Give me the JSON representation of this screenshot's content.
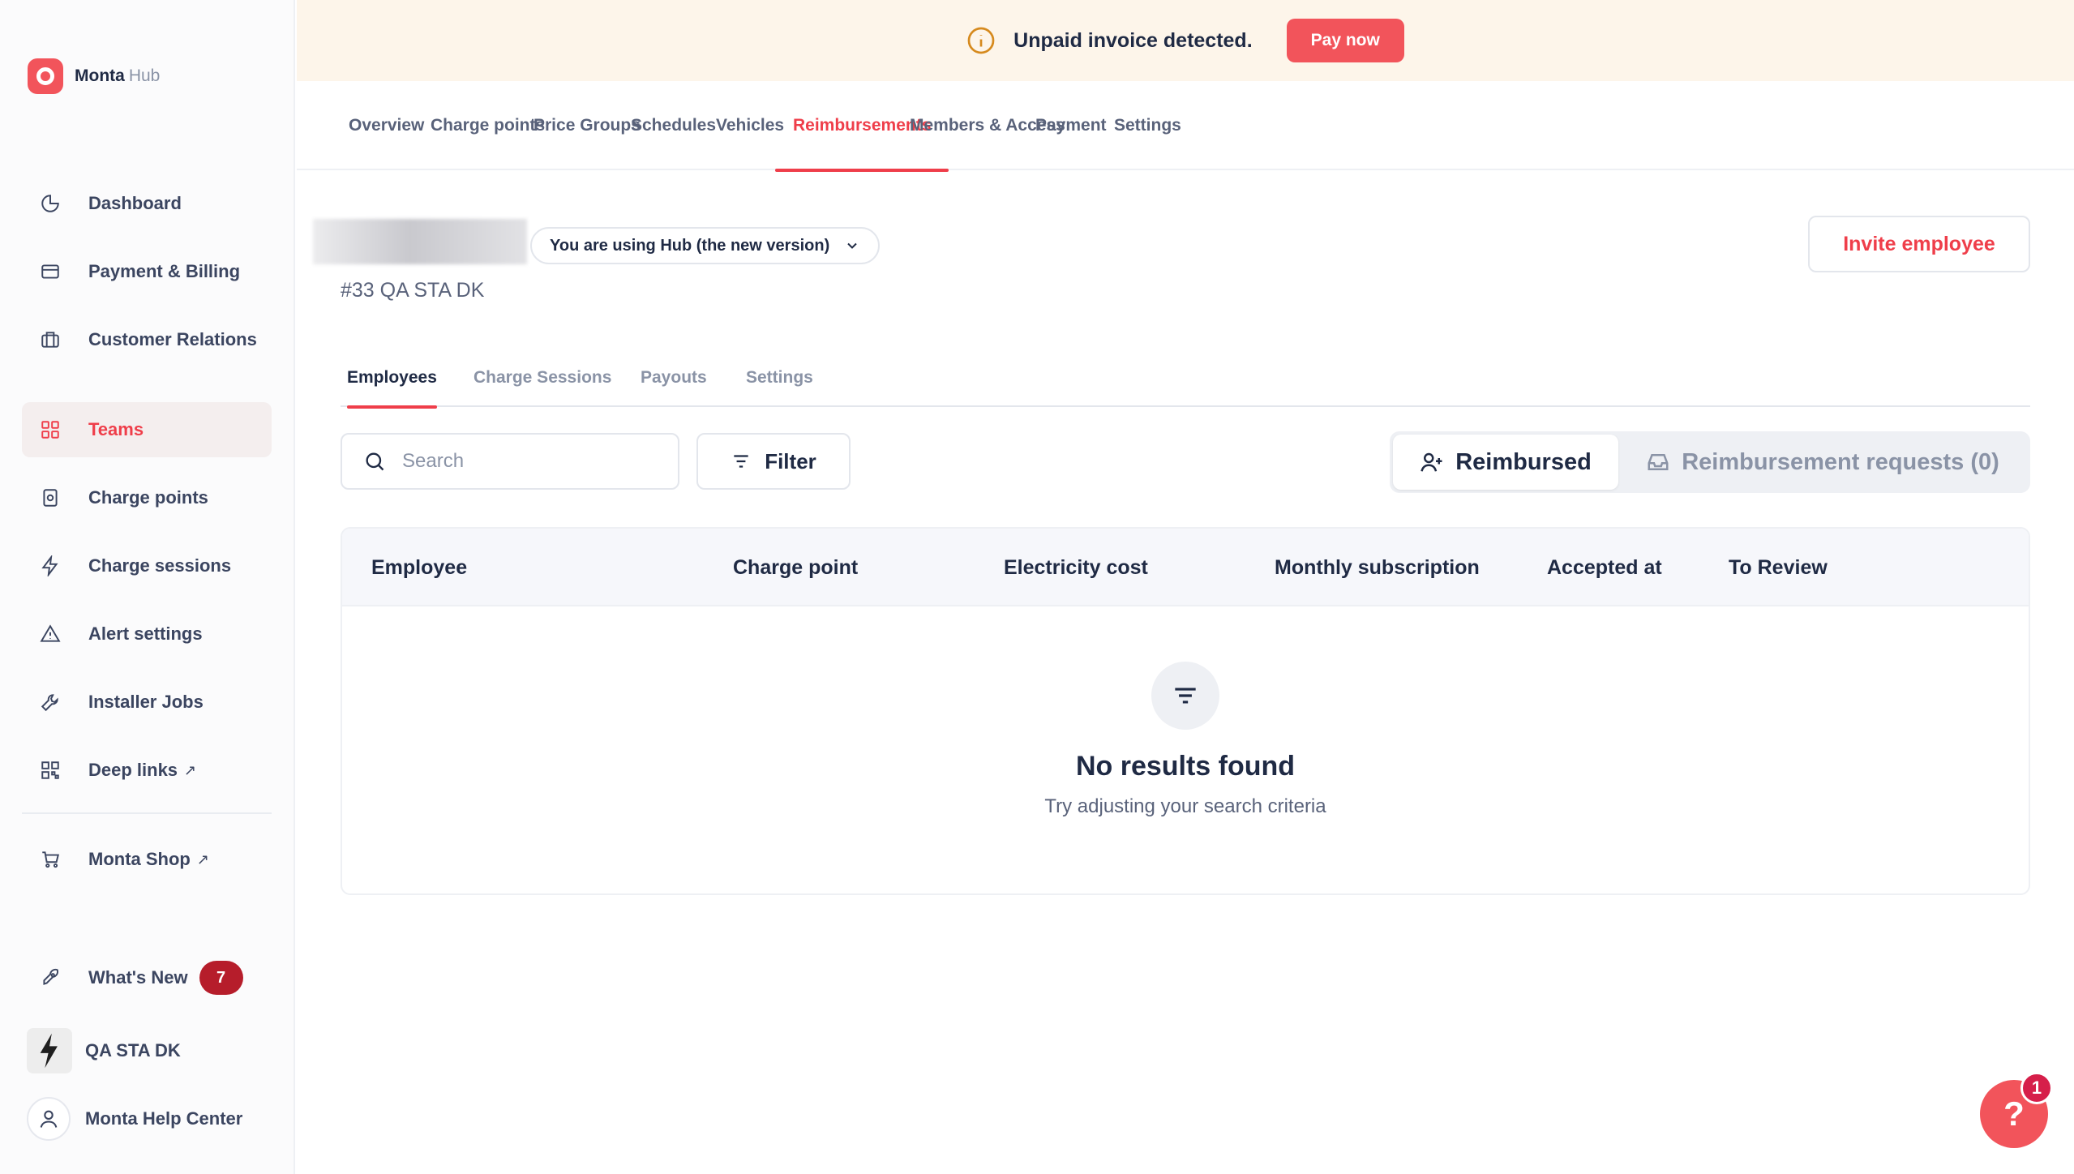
{
  "app": {
    "brand": "Monta",
    "brand_suffix": "Hub"
  },
  "sidebar": {
    "items": [
      {
        "label": "Dashboard",
        "icon": "pie-chart-icon"
      },
      {
        "label": "Payment & Billing",
        "icon": "credit-card-icon"
      },
      {
        "label": "Customer Relations",
        "icon": "briefcase-icon"
      },
      {
        "label": "Teams",
        "icon": "grid-icon",
        "active": true
      },
      {
        "label": "Charge points",
        "icon": "charger-icon"
      },
      {
        "label": "Charge sessions",
        "icon": "bolt-icon"
      },
      {
        "label": "Alert settings",
        "icon": "alert-triangle-icon"
      },
      {
        "label": "Installer Jobs",
        "icon": "wrench-icon"
      },
      {
        "label": "Deep links",
        "icon": "qr-code-icon",
        "external": true
      }
    ],
    "shop": {
      "label": "Monta Shop",
      "icon": "cart-icon",
      "external": true
    },
    "whats_new": {
      "label": "What's New",
      "count": "7"
    },
    "org": {
      "label": "QA STA DK"
    },
    "help_center": {
      "label": "Monta Help Center"
    },
    "external_glyph": "↗"
  },
  "banner": {
    "message": "Unpaid invoice detected.",
    "pay_label": "Pay now",
    "bg": "#fdf5ea"
  },
  "top_tabs": [
    "Overview",
    "Charge points",
    "Price Groups",
    "Schedules",
    "Vehicles",
    "Reimbursements",
    "Members & Access",
    "Payment",
    "Settings"
  ],
  "top_tabs_active": "Reimbursements",
  "header": {
    "version_label": "You are using Hub (the new version)",
    "team_code": "#33 QA STA DK",
    "invite_label": "Invite employee"
  },
  "sub_tabs": [
    "Employees",
    "Charge Sessions",
    "Payouts",
    "Settings"
  ],
  "sub_tabs_active": "Employees",
  "controls": {
    "search_placeholder": "Search",
    "filter_label": "Filter",
    "segment": {
      "reimbursed": "Reimbursed",
      "requests": "Reimbursement requests (0)"
    }
  },
  "table": {
    "columns": [
      "Employee",
      "Charge point",
      "Electricity cost",
      "Monthly subscription",
      "Accepted at",
      "To Review"
    ],
    "rows": [],
    "empty_title": "No results found",
    "empty_subtitle": "Try adjusting your search criteria"
  },
  "help": {
    "glyph": "?",
    "badge": "1"
  },
  "colors": {
    "accent": "#ef3e4a",
    "brand": "#f2545b",
    "badge": "#b61d2b"
  }
}
